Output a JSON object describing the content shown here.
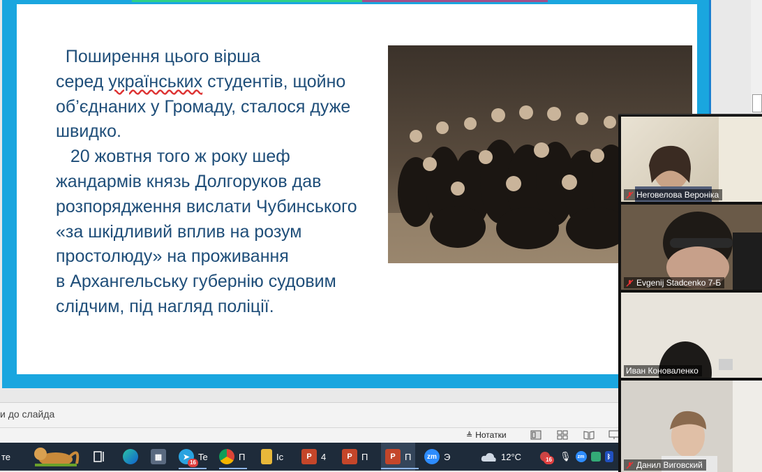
{
  "slide": {
    "lines": [
      "  Поширення цього вірша",
      "серед ",
      "українських",
      " студентів, щойно",
      "об’єднаних у Громаду, сталося дуже",
      "швидко.",
      "   20 жовтня того ж року шеф",
      "жандармів князь Долгоруков дав",
      "розпорядження вислати Чубинського",
      "«за шкідливий вплив на розум",
      "простолюду» на проживання",
      "в Архангельську губернію судовим",
      "слідчим, під нагляд поліції."
    ]
  },
  "notes": {
    "hint": "и до слайда"
  },
  "status": {
    "notes_label": "Нотатки"
  },
  "taskbar": {
    "items": [
      {
        "name": "Te",
        "badge": "16"
      },
      {
        "name": "П"
      },
      {
        "name": "Іс"
      },
      {
        "name": "4"
      },
      {
        "name": "П"
      },
      {
        "name": "П"
      },
      {
        "name": "Э"
      }
    ],
    "start_text": "те",
    "weather": "12°C",
    "tray_badge": "16"
  },
  "video": {
    "participants": [
      {
        "name": "Неговелова Вероніка",
        "muted": true
      },
      {
        "name": "Evgenij Stadcenko 7-Б",
        "muted": true
      },
      {
        "name": "Иван Коноваленко",
        "muted": false
      },
      {
        "name": "Данил Виговский",
        "muted": true
      }
    ]
  },
  "colors": {
    "slide_border": "#1aa6df",
    "slide_text": "#1f4e79",
    "taskbar": "#1e2b3a"
  }
}
